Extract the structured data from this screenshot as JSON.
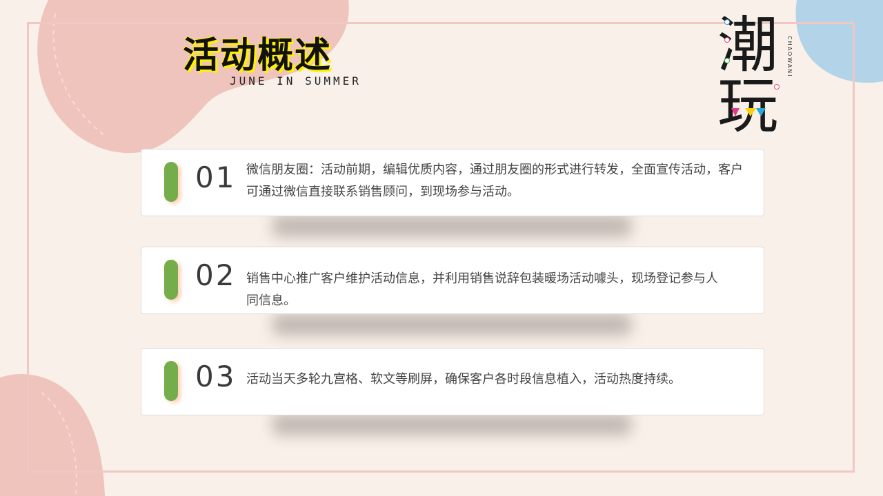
{
  "header": {
    "title": "活动概述",
    "subtitle": "JUNE IN SUMMER"
  },
  "logo": {
    "char_1": "潮",
    "char_2": "玩",
    "pinyin": "CHAOWANI"
  },
  "items": [
    {
      "number": "01",
      "text": "微信朋友圈：活动前期，编辑优质内容，通过朋友圈的形式进行转发，全面宣传活动，客户可通过微信直接联系销售顾问，到现场参与活动。"
    },
    {
      "number": "02",
      "text": "销售中心推广客户维护活动信息，并利用销售说辞包装暖场活动噱头，现场登记参与人同信息。"
    },
    {
      "number": "03",
      "text": "活动当天多轮九宫格、软文等刷屏，确保客户各时段信息植入，活动热度持续。"
    }
  ],
  "colors": {
    "background": "#f9f0e9",
    "blob_pink": "#efc4bd",
    "blob_blue": "#b3d4e8",
    "accent_green": "#74ad49",
    "title_highlight": "#fff200",
    "frame": "#f0c7c2"
  }
}
